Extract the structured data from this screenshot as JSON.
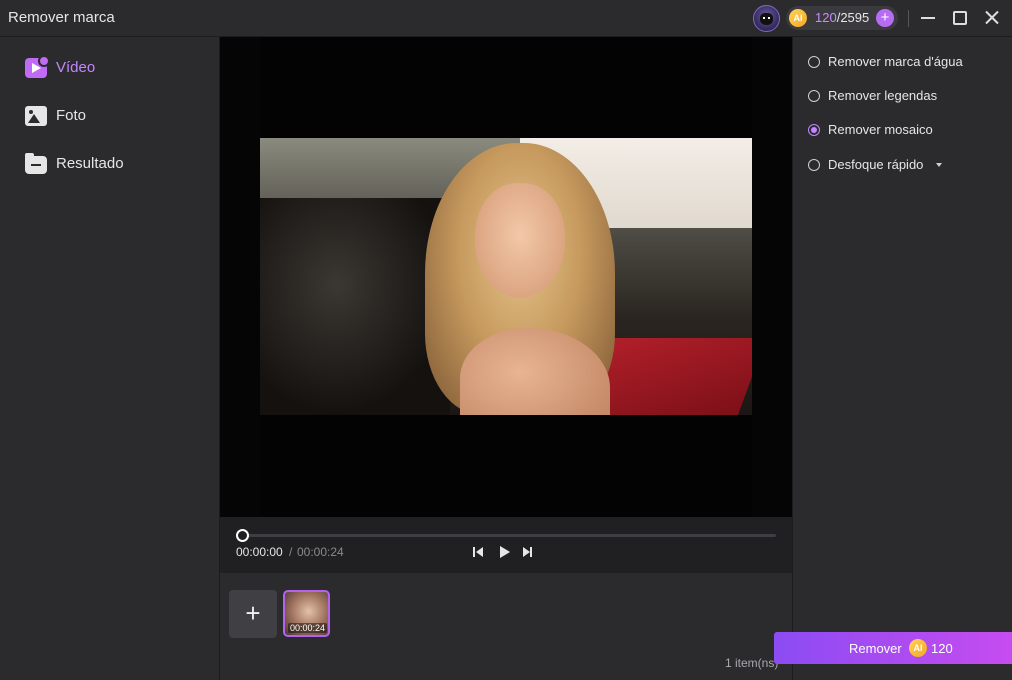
{
  "window": {
    "title": "Remover marca",
    "credits": {
      "ai_badge": "AI",
      "used": "120",
      "total": "/2595",
      "add": "+"
    }
  },
  "sidebar": {
    "items": [
      {
        "label": "Vídeo",
        "icon": "video-icon",
        "active": true
      },
      {
        "label": "Foto",
        "icon": "photo-icon",
        "active": false
      },
      {
        "label": "Resultado",
        "icon": "folder-icon",
        "active": false
      }
    ]
  },
  "player": {
    "current_time": "00:00:00",
    "separator": "/",
    "total_time": "00:00:24",
    "progress": 0
  },
  "media": {
    "add_label": "+",
    "thumbnails": [
      {
        "duration": "00:00:24",
        "selected": true
      }
    ],
    "item_count": "1 item(ns)"
  },
  "options": {
    "items": [
      {
        "label": "Remover marca d'água",
        "checked": false
      },
      {
        "label": "Remover legendas",
        "checked": false
      },
      {
        "label": "Remover mosaico",
        "checked": true
      },
      {
        "label": "Desfoque rápido",
        "checked": false,
        "has_dropdown": true
      }
    ]
  },
  "action": {
    "remove_label": "Remover",
    "ai_badge": "AI",
    "cost": "120"
  },
  "colors": {
    "accent": "#c286ff",
    "button_gradient_start": "#8b4cf2",
    "button_gradient_end": "#c64cf0",
    "background": "#2b2b2e"
  }
}
